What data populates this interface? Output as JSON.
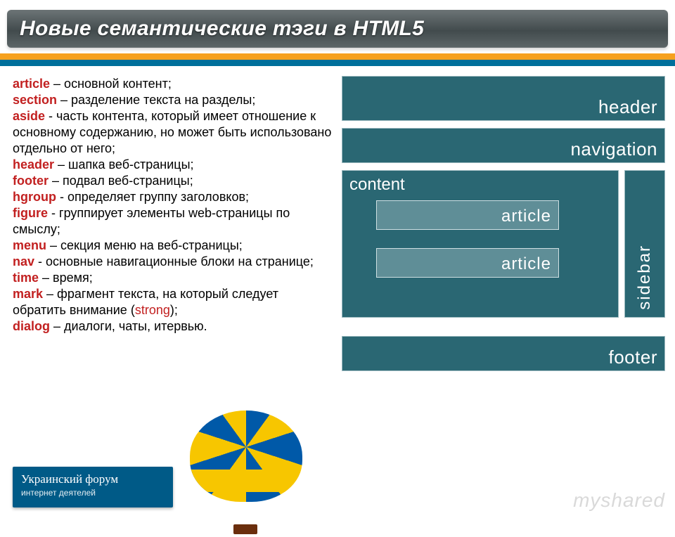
{
  "title": "Новые семантические тэги в HTML5",
  "strong_word": "strong",
  "definitions": [
    {
      "kw": "article",
      "txt": " – основной контент;"
    },
    {
      "kw": "section",
      "txt": " – разделение текста на разделы;"
    },
    {
      "kw": "aside",
      "txt": " - часть контента, который имеет отношение к основному содержанию, но может быть использовано отдельно от него;"
    },
    {
      "kw": "header",
      "txt": " – шапка веб-страницы;"
    },
    {
      "kw": "footer",
      "txt": " – подвал веб-страницы;"
    },
    {
      "kw": "hgroup",
      "txt": " - определяет группу заголовков;"
    },
    {
      "kw": "figure",
      "txt": " - группирует элементы web-страницы по смыслу;"
    },
    {
      "kw": "menu",
      "txt": " – секция меню на веб-страницы;"
    },
    {
      "kw": "nav",
      "txt": " - основные навигационные блоки на странице;"
    },
    {
      "kw": "time",
      "txt": " – время;"
    },
    {
      "kw": "mark",
      "txt": " – фрагмент текста, на который следует обратить внимание "
    },
    {
      "kw": "dialog",
      "txt": " – диалоги, чаты, итервью."
    }
  ],
  "mark_suffix": ");",
  "diagram": {
    "header": "header",
    "navigation": "navigation",
    "content": "content",
    "article1": "article",
    "article2": "article",
    "sidebar": "sidebar",
    "footer": "footer"
  },
  "forum": {
    "line1": "Украинский форум",
    "line2": "интернет деятелей"
  },
  "watermark": "myshared"
}
